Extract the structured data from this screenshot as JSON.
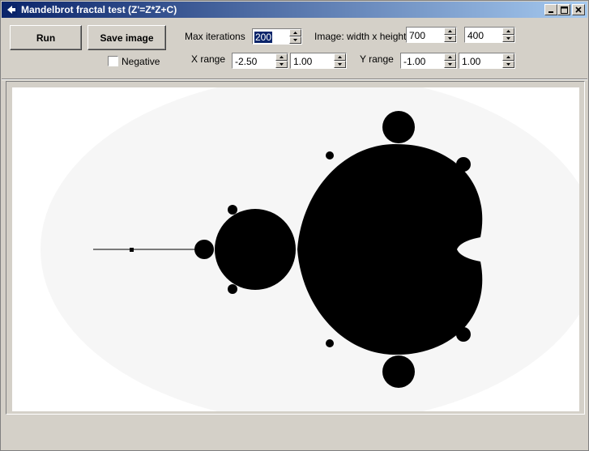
{
  "window": {
    "title": "Mandelbrot fractal test (Z'=Z*Z+C)"
  },
  "toolbar": {
    "run_label": "Run",
    "save_label": "Save image",
    "negative_label": "Negative",
    "negative_checked": false
  },
  "params": {
    "max_iterations_label": "Max iterations",
    "max_iterations": "200",
    "image_size_label": "Image: width x height",
    "width": "700",
    "height": "400",
    "x_range_label": "X range",
    "x_min": "-2.50",
    "x_max": "1.00",
    "y_range_label": "Y range",
    "y_min": "-1.00",
    "y_max": "1.00"
  },
  "colors": {
    "set": "#000000",
    "background": "#ffffff",
    "window": "#d4d0c8",
    "titlebar_start": "#0a246a",
    "titlebar_end": "#a6caf0"
  },
  "icons": {
    "app": "fractal-app-icon",
    "minimize": "minimize-icon",
    "maximize": "maximize-icon",
    "close": "close-icon"
  }
}
